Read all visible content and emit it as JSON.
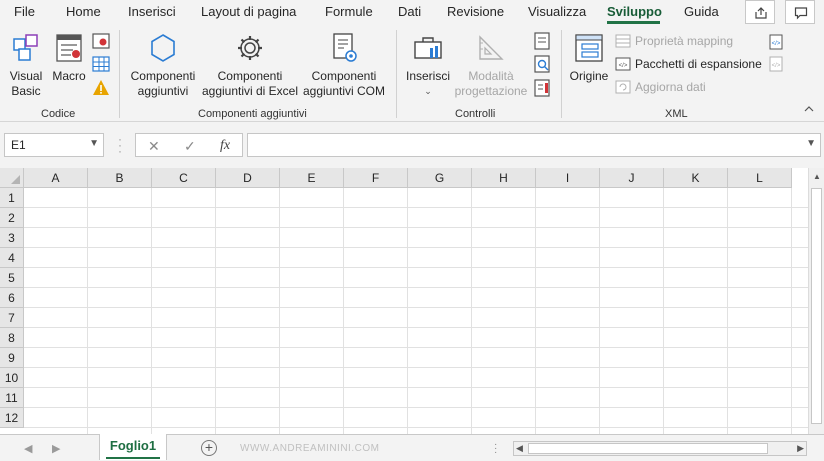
{
  "menu": {
    "tabs": [
      {
        "label": "File"
      },
      {
        "label": "Home"
      },
      {
        "label": "Inserisci"
      },
      {
        "label": "Layout di pagina"
      },
      {
        "label": "Formule"
      },
      {
        "label": "Dati"
      },
      {
        "label": "Revisione"
      },
      {
        "label": "Visualizza"
      },
      {
        "label": "Sviluppo"
      },
      {
        "label": "Guida"
      }
    ],
    "active_tab": "Sviluppo"
  },
  "ribbon": {
    "codice": {
      "label": "Codice",
      "visual_basic_line1": "Visual",
      "visual_basic_line2": "Basic",
      "macro": "Macro"
    },
    "componenti": {
      "label": "Componenti aggiuntivi",
      "btn1_line1": "Componenti",
      "btn1_line2": "aggiuntivi",
      "btn2_line1": "Componenti",
      "btn2_line2": "aggiuntivi di Excel",
      "btn3_line1": "Componenti",
      "btn3_line2": "aggiuntivi COM"
    },
    "controlli": {
      "label": "Controlli",
      "inserisci": "Inserisci",
      "modalita_line1": "Modalità",
      "modalita_line2": "progettazione"
    },
    "xml": {
      "label": "XML",
      "origine": "Origine",
      "proprieta_mapping": "Proprietà mapping",
      "pacchetti": "Pacchetti di espansione",
      "aggiorna": "Aggiorna dati"
    }
  },
  "formula_bar": {
    "name_box": "E1",
    "fx_label": "fx",
    "formula_value": ""
  },
  "grid": {
    "columns": [
      "A",
      "B",
      "C",
      "D",
      "E",
      "F",
      "G",
      "H",
      "I",
      "J",
      "K",
      "L"
    ],
    "rows": [
      "1",
      "2",
      "3",
      "4",
      "5",
      "6",
      "7",
      "8",
      "9",
      "10",
      "11",
      "12"
    ]
  },
  "sheets": {
    "active": "Foglio1",
    "watermark": "WWW.ANDREAMININI.COM"
  },
  "colors": {
    "accent": "#217346",
    "active_tab_text": "#185c37",
    "warning": "#e8a400",
    "disabled_text": "#a6a6a6"
  }
}
